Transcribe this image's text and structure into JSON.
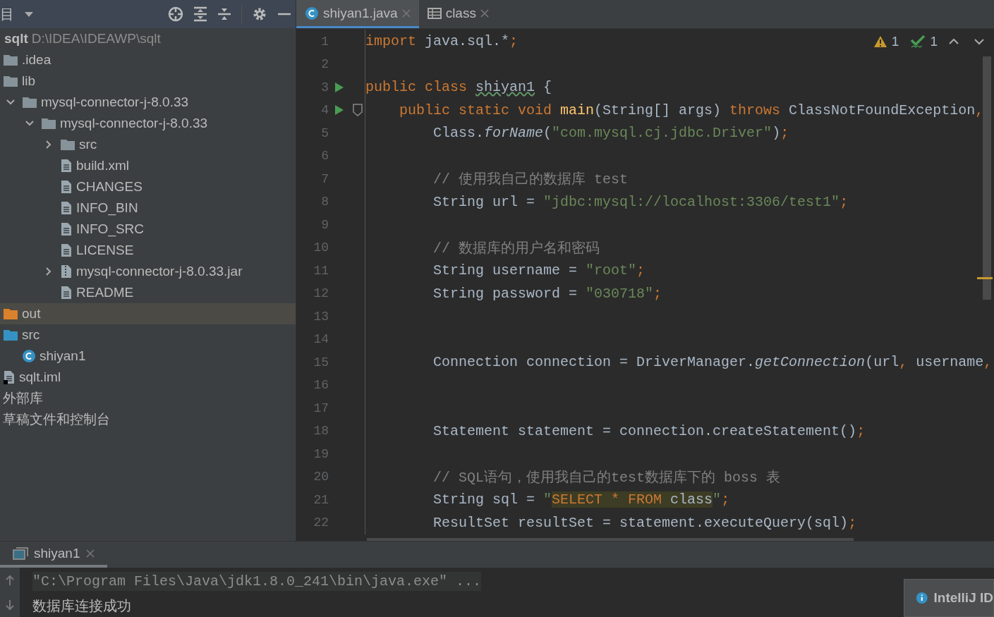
{
  "project_panel": {
    "title": "目",
    "project": {
      "name": "sqlt",
      "path": "D:\\IDEA\\IDEAWP\\sqlt"
    },
    "items": [
      {
        "name": ".idea",
        "kind": "folder",
        "selected": false
      },
      {
        "name": "lib",
        "kind": "folder",
        "selected": false
      },
      {
        "name": "mysql-connector-j-8.0.33",
        "kind": "folder",
        "selected": false,
        "expanded": true,
        "children": [
          {
            "name": "mysql-connector-j-8.0.33",
            "kind": "folder",
            "selected": false,
            "expanded": true,
            "children": [
              {
                "name": "src",
                "kind": "folder",
                "selected": false,
                "expanded": false
              },
              {
                "name": "build.xml",
                "kind": "xml",
                "selected": false
              },
              {
                "name": "CHANGES",
                "kind": "text",
                "selected": false
              },
              {
                "name": "INFO_BIN",
                "kind": "text",
                "selected": false
              },
              {
                "name": "INFO_SRC",
                "kind": "text",
                "selected": false
              },
              {
                "name": "LICENSE",
                "kind": "text",
                "selected": false
              },
              {
                "name": "mysql-connector-j-8.0.33.jar",
                "kind": "jar",
                "selected": false,
                "expanded": false
              },
              {
                "name": "README",
                "kind": "text",
                "selected": false
              }
            ]
          }
        ]
      },
      {
        "name": "out",
        "kind": "excluded-folder",
        "selected": true
      },
      {
        "name": "src",
        "kind": "source-folder",
        "selected": false,
        "children": [
          {
            "name": "shiyan1",
            "kind": "class",
            "selected": false
          }
        ]
      },
      {
        "name": "sqlt.iml",
        "kind": "iml",
        "selected": false
      },
      {
        "name": "外部库",
        "kind": "plain",
        "selected": false
      },
      {
        "name": "草稿文件和控制台",
        "kind": "plain",
        "selected": false
      }
    ]
  },
  "editor_tabs": [
    {
      "label": "shiyan1.java",
      "kind": "class",
      "selected": true
    },
    {
      "label": "class",
      "kind": "table",
      "selected": false
    }
  ],
  "inspections": {
    "warnings": "1",
    "typos": "1"
  },
  "code_lines": [
    {
      "number": "1",
      "tokens": [
        {
          "text": "import",
          "kind": "kw"
        },
        {
          "text": " java.sql.*",
          "kind": "id"
        },
        {
          "text": ";",
          "kind": "punct"
        }
      ]
    },
    {
      "number": "2"
    },
    {
      "number": "3",
      "gutter": [
        {
          "kind": "run"
        }
      ],
      "tokens": [
        {
          "text": "public class ",
          "kind": "kw"
        },
        {
          "text": "shiyan1",
          "kind": "typo"
        },
        {
          "text": " {",
          "kind": "id"
        }
      ]
    },
    {
      "number": "4",
      "gutter": [
        {
          "kind": "run"
        },
        {
          "kind": "method"
        }
      ],
      "tokens": [
        {
          "text": "    public static void ",
          "kind": "kw"
        },
        {
          "text": "main",
          "kind": "decl"
        },
        {
          "text": "(String[] args) ",
          "kind": "id"
        },
        {
          "text": "throws ",
          "kind": "kw"
        },
        {
          "text": "ClassNotFoundException",
          "kind": "id"
        },
        {
          "text": ",",
          "kind": "punct"
        }
      ]
    },
    {
      "number": "5",
      "tokens": [
        {
          "text": "        Class.",
          "kind": "id"
        },
        {
          "text": "forName",
          "kind": "static"
        },
        {
          "text": "(",
          "kind": "id"
        },
        {
          "text": "\"com.mysql.cj.jdbc.Driver\"",
          "kind": "str"
        },
        {
          "text": ")",
          "kind": "id"
        },
        {
          "text": ";",
          "kind": "punct"
        }
      ]
    },
    {
      "number": "6"
    },
    {
      "number": "7",
      "tokens": [
        {
          "text": "        // 使用我自己的数据库 test",
          "kind": "cmt"
        }
      ]
    },
    {
      "number": "8",
      "tokens": [
        {
          "text": "        String url = ",
          "kind": "id"
        },
        {
          "text": "\"jdbc:mysql://localhost:3306/test1\"",
          "kind": "str"
        },
        {
          "text": ";",
          "kind": "punct"
        }
      ]
    },
    {
      "number": "9"
    },
    {
      "number": "10",
      "tokens": [
        {
          "text": "        // 数据库的用户名和密码",
          "kind": "cmt"
        }
      ]
    },
    {
      "number": "11",
      "tokens": [
        {
          "text": "        String username = ",
          "kind": "id"
        },
        {
          "text": "\"root\"",
          "kind": "str"
        },
        {
          "text": ";",
          "kind": "punct"
        }
      ]
    },
    {
      "number": "12",
      "tokens": [
        {
          "text": "        String password = ",
          "kind": "id"
        },
        {
          "text": "\"030718\"",
          "kind": "str"
        },
        {
          "text": ";",
          "kind": "punct"
        }
      ]
    },
    {
      "number": "13"
    },
    {
      "number": "14"
    },
    {
      "number": "15",
      "tokens": [
        {
          "text": "        Connection connection = DriverManager.",
          "kind": "id"
        },
        {
          "text": "getConnection",
          "kind": "static"
        },
        {
          "text": "(url",
          "kind": "id"
        },
        {
          "text": ",",
          "kind": "punct"
        },
        {
          "text": " username",
          "kind": "id"
        },
        {
          "text": ",",
          "kind": "punct"
        }
      ]
    },
    {
      "number": "16"
    },
    {
      "number": "17"
    },
    {
      "number": "18",
      "tokens": [
        {
          "text": "        Statement statement = connection.createStatement()",
          "kind": "id"
        },
        {
          "text": ";",
          "kind": "punct"
        }
      ]
    },
    {
      "number": "19"
    },
    {
      "number": "20",
      "tokens": [
        {
          "text": "        // SQL语句，使用我自己的test数据库下的 boss 表",
          "kind": "cmt"
        }
      ]
    },
    {
      "number": "21",
      "tokens": [
        {
          "text": "        String sql = ",
          "kind": "id"
        },
        {
          "text": "\"",
          "kind": "str"
        },
        {
          "text": "SELECT * FROM",
          "kind": "injkw"
        },
        {
          "text": " class",
          "kind": "injtext"
        },
        {
          "text": "\"",
          "kind": "str"
        },
        {
          "text": ";",
          "kind": "punct"
        }
      ]
    },
    {
      "number": "22",
      "tokens": [
        {
          "text": "        ResultSet resultSet = statement.executeQuery(sql)",
          "kind": "id"
        },
        {
          "text": ";",
          "kind": "punct"
        }
      ]
    }
  ],
  "run_panel": {
    "tabs": [
      {
        "label": "shiyan1",
        "selected": true
      }
    ],
    "output": [
      {
        "text": "\"C:\\Program Files\\Java\\jdk1.8.0_241\\bin\\java.exe\" ...",
        "kind": "command"
      },
      {
        "text": "数据库连接成功",
        "kind": "stdout"
      }
    ]
  },
  "notification": {
    "title": "IntelliJ ID"
  }
}
